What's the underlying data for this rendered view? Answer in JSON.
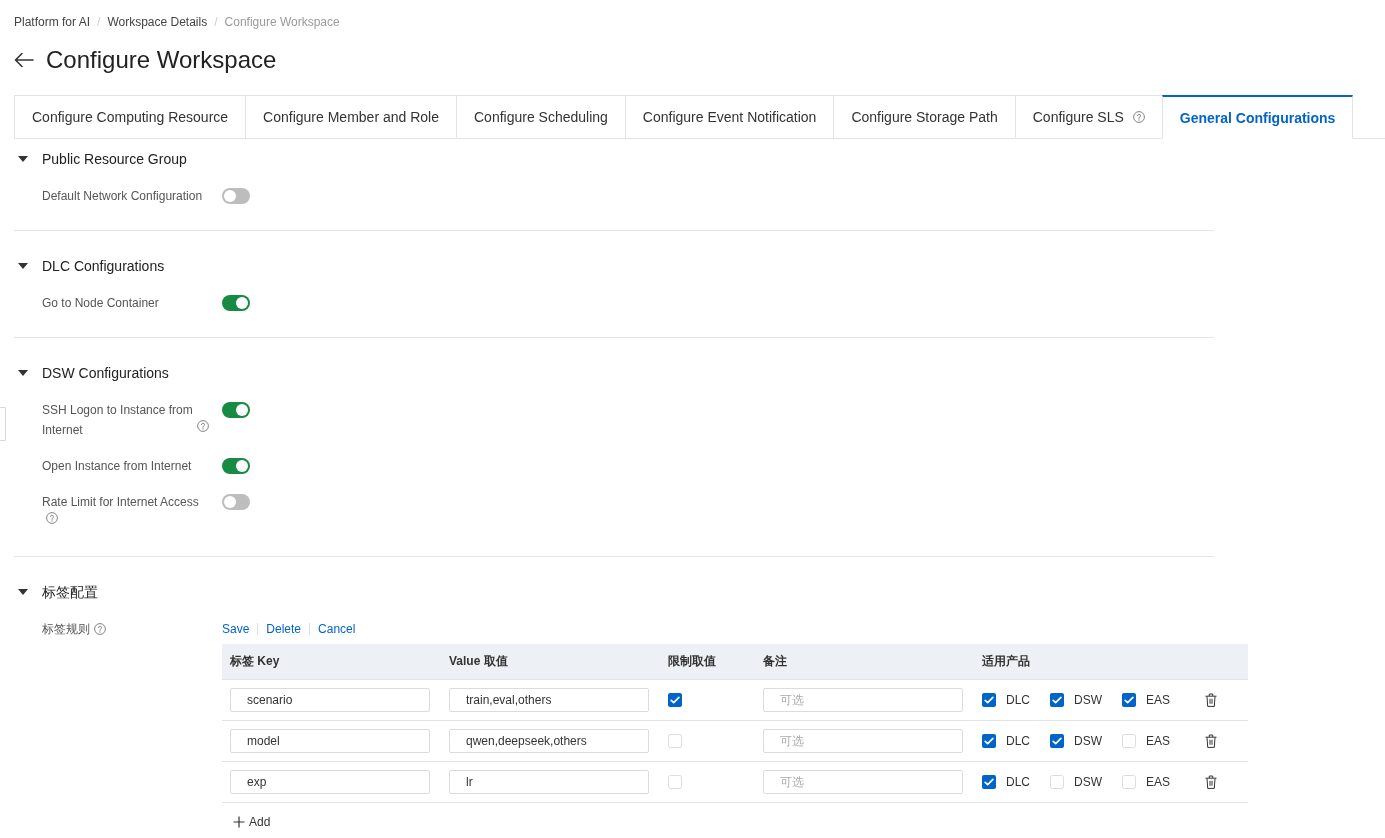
{
  "breadcrumb": [
    {
      "label": "Platform for AI",
      "current": false,
      "separator_after": "/"
    },
    {
      "label": "Workspace Details",
      "current": false,
      "separator_after": "/"
    },
    {
      "label": "Configure Workspace",
      "current": true
    }
  ],
  "page": {
    "title": "Configure Workspace"
  },
  "tabs": [
    {
      "label": "Configure Computing Resource",
      "selected": false,
      "help": false
    },
    {
      "label": "Configure Member and Role",
      "selected": false,
      "help": false
    },
    {
      "label": "Configure Scheduling",
      "selected": false,
      "help": false
    },
    {
      "label": "Configure Event Notification",
      "selected": false,
      "help": false
    },
    {
      "label": "Configure Storage Path",
      "selected": false,
      "help": false
    },
    {
      "label": "Configure SLS",
      "selected": false,
      "help": true
    },
    {
      "label": "General Configurations",
      "selected": true,
      "help": false
    }
  ],
  "sections": [
    {
      "kind": "toggles",
      "title": "Public Resource Group",
      "expanded": true,
      "settings": [
        {
          "label": "Default Network Configuration",
          "help": false,
          "on": false
        }
      ]
    },
    {
      "kind": "toggles",
      "title": "DLC Configurations",
      "expanded": true,
      "settings": [
        {
          "label": "Go to Node Container",
          "help": false,
          "on": true
        }
      ]
    },
    {
      "kind": "toggles",
      "title": "DSW Configurations",
      "expanded": true,
      "settings": [
        {
          "label": "SSH Logon to Instance from Internet",
          "help": true,
          "on": true
        },
        {
          "label": "Open Instance from Internet",
          "help": false,
          "on": true
        },
        {
          "label": "Rate Limit for Internet Access",
          "help": true,
          "on": false
        }
      ]
    },
    {
      "kind": "tag_rules",
      "title": "标签配置",
      "expanded": true,
      "field_label": "标签规则",
      "help": true,
      "actions": [
        "Save",
        "Delete",
        "Cancel"
      ],
      "table": {
        "columns": [
          "标签 Key",
          "Value 取值",
          "限制取值",
          "备注",
          "适用产品"
        ],
        "rows": [
          {
            "key": "scenario",
            "value": "train,eval,others",
            "restricted": true,
            "note": {
              "placeholder": "可选"
            },
            "products": [
              {
                "label": "DLC",
                "checked": true
              },
              {
                "label": "DSW",
                "checked": true
              },
              {
                "label": "EAS",
                "checked": true
              }
            ]
          },
          {
            "key": "model",
            "value": "qwen,deepseek,others",
            "restricted": false,
            "note": {
              "placeholder": "可选"
            },
            "products": [
              {
                "label": "DLC",
                "checked": true
              },
              {
                "label": "DSW",
                "checked": true
              },
              {
                "label": "EAS",
                "checked": false
              }
            ]
          },
          {
            "key": "exp",
            "value": "lr",
            "restricted": false,
            "note": {
              "placeholder": "可选"
            },
            "products": [
              {
                "label": "DLC",
                "checked": true
              },
              {
                "label": "DSW",
                "checked": false
              },
              {
                "label": "EAS",
                "checked": false
              }
            ]
          }
        ]
      },
      "add_label": "Add"
    }
  ]
}
